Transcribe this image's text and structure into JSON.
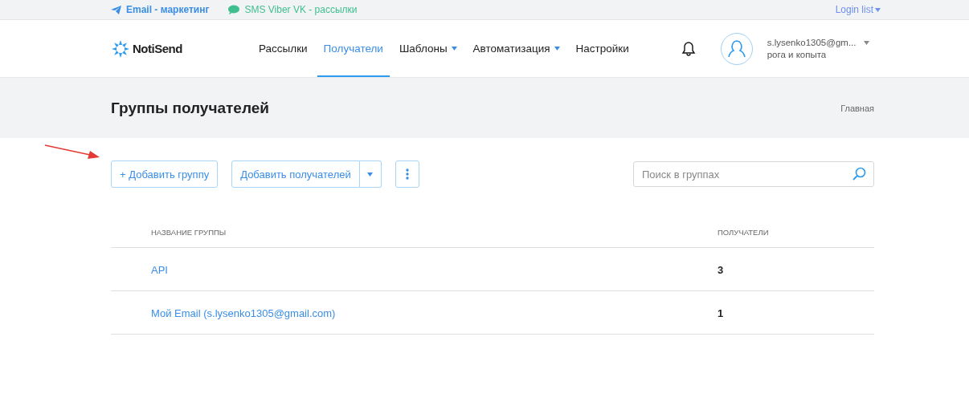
{
  "top_bar": {
    "links": [
      {
        "kind": "email",
        "label": "Email - маркетинг"
      },
      {
        "kind": "sms",
        "label": "SMS Viber VK - рассылки"
      }
    ],
    "login_list": "Login list"
  },
  "header": {
    "logo": "NotiSend",
    "nav": [
      {
        "label": "Рассылки",
        "selected": false,
        "has_menu": false
      },
      {
        "label": "Получатели",
        "selected": true,
        "has_menu": false
      },
      {
        "label": "Шаблоны",
        "selected": false,
        "has_menu": true
      },
      {
        "label": "Автоматизация",
        "selected": false,
        "has_menu": true
      },
      {
        "label": "Настройки",
        "selected": false,
        "has_menu": false
      }
    ],
    "user": {
      "email": "s.lysenko1305@gm...",
      "company": "рога и копыта"
    }
  },
  "page_title": "Группы получателей",
  "breadcrumb": "Главная",
  "toolbar": {
    "add_group": "+ Добавить группу",
    "add_recipients": "Добавить получателей",
    "search": {
      "placeholder": "Поиск в группах"
    }
  },
  "table": {
    "columns": [
      "НАЗВАНИЕ ГРУППЫ",
      "ПОЛУЧАТЕЛИ"
    ],
    "rows": [
      {
        "name": "API",
        "count": "3"
      },
      {
        "name": "Мой Email (s.lysenko1305@gmail.com)",
        "count": "1"
      }
    ]
  }
}
